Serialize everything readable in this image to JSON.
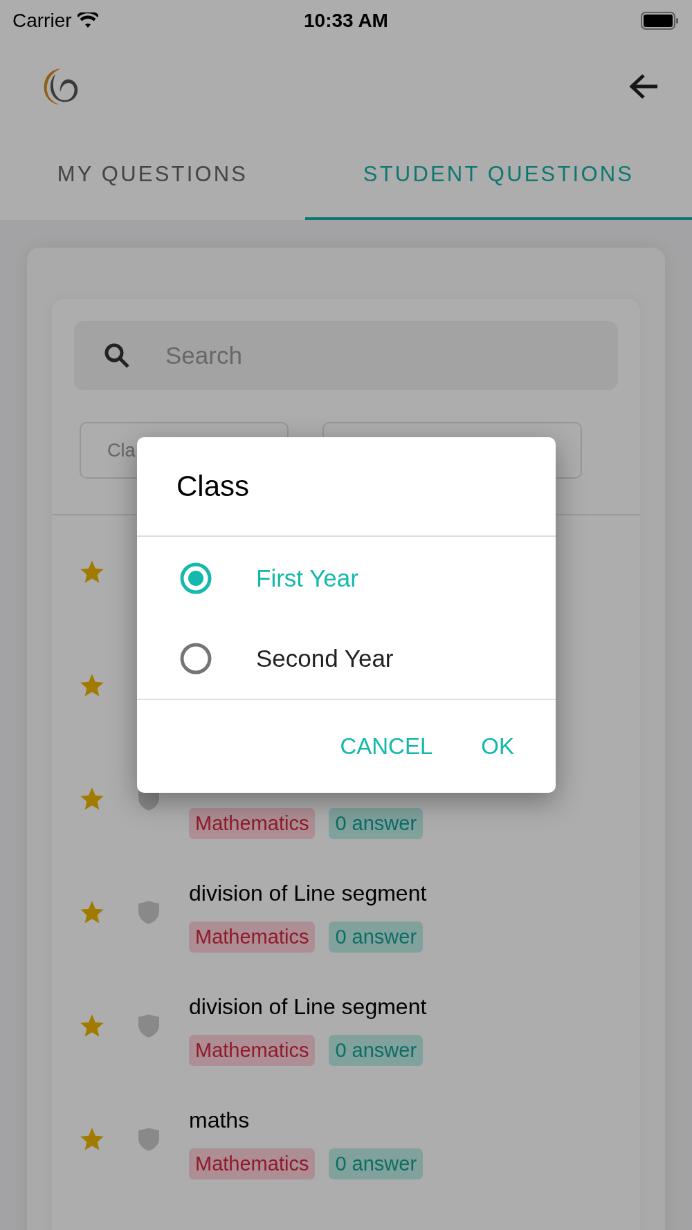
{
  "status_bar": {
    "carrier": "Carrier",
    "time": "10:33 AM"
  },
  "tabs": [
    {
      "label": "MY QUESTIONS",
      "selected": false
    },
    {
      "label": "STUDENT QUESTIONS",
      "selected": true
    }
  ],
  "search": {
    "placeholder": "Search"
  },
  "filters": [
    {
      "label": "Cla"
    }
  ],
  "questions": [
    {
      "kind": "covered"
    },
    {
      "kind": "covered"
    },
    {
      "kind": "lower",
      "tags": [
        {
          "text": "Mathematics",
          "kind": "subject"
        },
        {
          "text": "0 answer",
          "kind": "answers"
        }
      ]
    },
    {
      "kind": "full",
      "title": "division of Line segment",
      "tags": [
        {
          "text": "Mathematics",
          "kind": "subject"
        },
        {
          "text": "0 answer",
          "kind": "answers"
        }
      ]
    },
    {
      "kind": "full",
      "title": "division of Line segment",
      "tags": [
        {
          "text": "Mathematics",
          "kind": "subject"
        },
        {
          "text": "0 answer",
          "kind": "answers"
        }
      ]
    },
    {
      "kind": "full",
      "title": "maths",
      "tags": [
        {
          "text": "Mathematics",
          "kind": "subject"
        },
        {
          "text": "0 answer",
          "kind": "answers"
        }
      ]
    }
  ],
  "dialog": {
    "title": "Class",
    "options": [
      {
        "label": "First Year",
        "selected": true
      },
      {
        "label": "Second Year",
        "selected": false
      }
    ],
    "buttons": [
      "CANCEL",
      "OK"
    ]
  }
}
